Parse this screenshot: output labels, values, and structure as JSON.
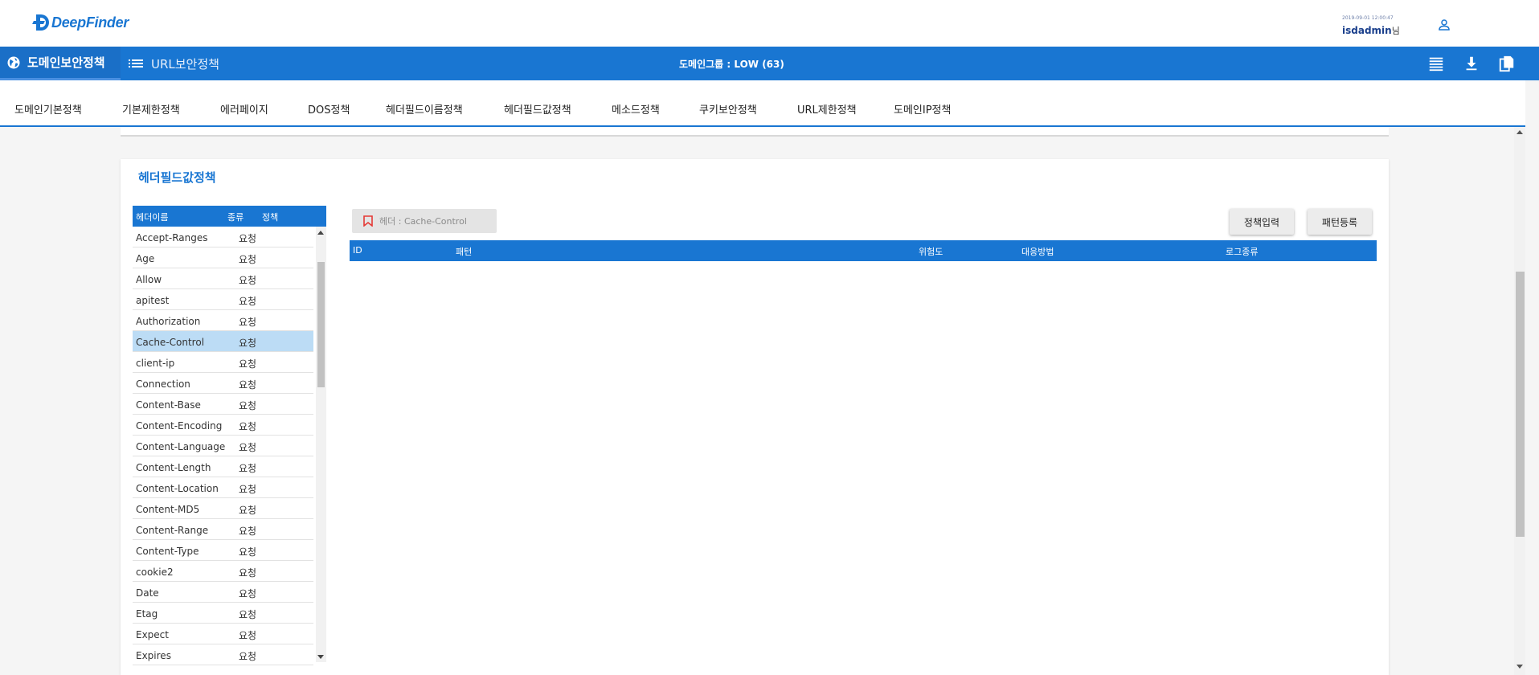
{
  "header": {
    "logo_text": "DeepFinder",
    "timestamp": "2019-09-01 12:00:47",
    "username": "isdadmin",
    "username_suffix": "님"
  },
  "nav": {
    "tab1_label": "도메인보안정책",
    "tab2_label": "URL보안정책",
    "center_text": "도메인그룹 : LOW (63)"
  },
  "subtabs": [
    "도메인기본정책",
    "기본제한정책",
    "에러페이지",
    "DOS정책",
    "헤더필드이름정책",
    "헤더필드값정책",
    "메소드정책",
    "쿠키보안정책",
    "URL제한정책",
    "도메인IP정책"
  ],
  "section": {
    "title": "헤더필드값정책"
  },
  "header_list": {
    "columns": [
      "헤더이름",
      "종류",
      "정책"
    ],
    "rows": [
      {
        "name": "Accept-Ranges",
        "type": "요청"
      },
      {
        "name": "Age",
        "type": "요청"
      },
      {
        "name": "Allow",
        "type": "요청"
      },
      {
        "name": "apitest",
        "type": "요청"
      },
      {
        "name": "Authorization",
        "type": "요청"
      },
      {
        "name": "Cache-Control",
        "type": "요청"
      },
      {
        "name": "client-ip",
        "type": "요청"
      },
      {
        "name": "Connection",
        "type": "요청"
      },
      {
        "name": "Content-Base",
        "type": "요청"
      },
      {
        "name": "Content-Encoding",
        "type": "요청"
      },
      {
        "name": "Content-Language",
        "type": "요청"
      },
      {
        "name": "Content-Length",
        "type": "요청"
      },
      {
        "name": "Content-Location",
        "type": "요청"
      },
      {
        "name": "Content-MD5",
        "type": "요청"
      },
      {
        "name": "Content-Range",
        "type": "요청"
      },
      {
        "name": "Content-Type",
        "type": "요청"
      },
      {
        "name": "cookie2",
        "type": "요청"
      },
      {
        "name": "Date",
        "type": "요청"
      },
      {
        "name": "Etag",
        "type": "요청"
      },
      {
        "name": "Expect",
        "type": "요청"
      },
      {
        "name": "Expires",
        "type": "요청"
      }
    ],
    "selected": "Cache-Control"
  },
  "chip": {
    "text": "헤더 : Cache-Control"
  },
  "buttons": {
    "policy_input": "정책입력",
    "pattern_register": "패턴등록"
  },
  "pattern_table": {
    "columns": [
      "ID",
      "패턴",
      "위험도",
      "대응방법",
      "로그종류"
    ]
  },
  "colors": {
    "primary": "#1976d2",
    "selected_row": "#bcdcf5",
    "bookmark": "#e53935"
  }
}
